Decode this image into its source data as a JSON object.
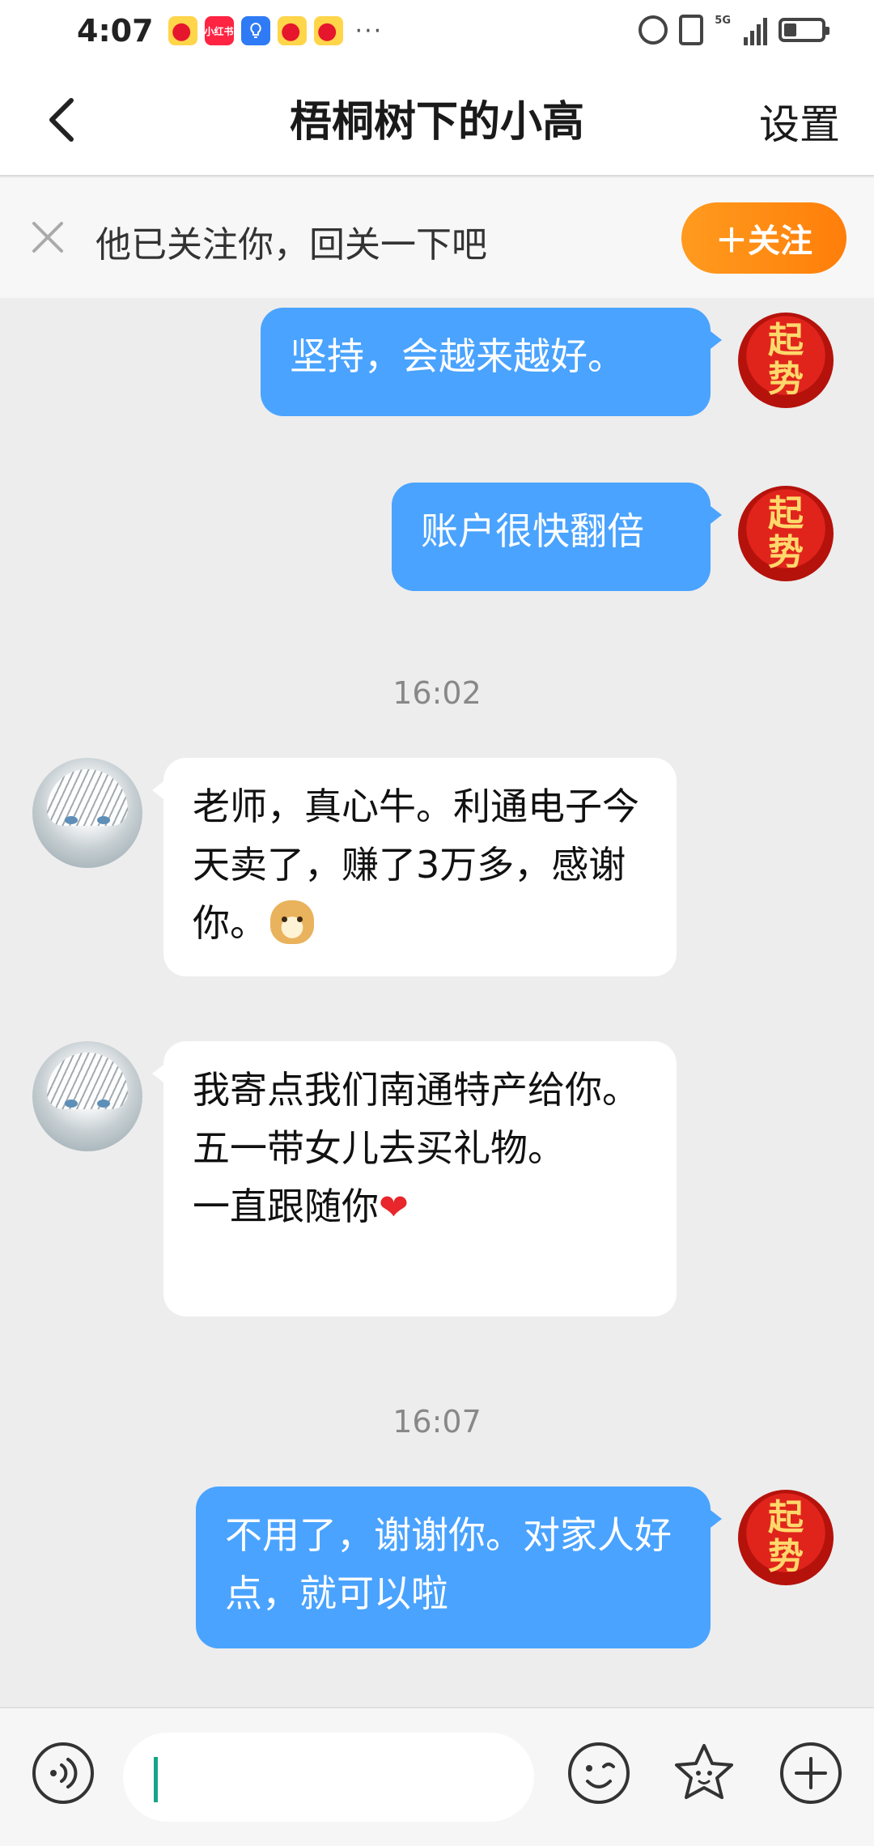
{
  "status_bar": {
    "time": "4:07",
    "notifications": [
      "weibo-icon",
      "xiaohongshu-icon",
      "bulb-icon",
      "weibo-icon",
      "weibo-icon"
    ],
    "xhs_label": "小红书",
    "more": "···",
    "network": "5G",
    "battery_level": 0.35
  },
  "nav": {
    "title": "梧桐树下的小高",
    "settings_label": "设置"
  },
  "follow_banner": {
    "text": "他已关注你，回关一下吧",
    "button_label": "＋关注",
    "accent_color": "#ff8a14"
  },
  "self_avatar_text": [
    "起",
    "势"
  ],
  "messages": [
    {
      "type": "out",
      "text": "坚持，会越来越好。"
    },
    {
      "type": "out",
      "text": "账户很快翻倍"
    },
    {
      "type": "time",
      "text": "16:02"
    },
    {
      "type": "in",
      "text": "老师，真心牛。利通电子今天卖了，赚了3万多，感谢你。",
      "emoji": "doge-emoji"
    },
    {
      "type": "in",
      "lines": [
        "我寄点我们南通特产给你。",
        "五一带女儿去买礼物。",
        "一直跟随你"
      ],
      "emoji": "heart-emoji"
    },
    {
      "type": "time",
      "text": "16:07"
    },
    {
      "type": "out",
      "text": "不用了，谢谢你。对家人好点，就可以啦"
    }
  ],
  "colors": {
    "outgoing_bubble": "#4aa3ff",
    "incoming_bubble": "#ffffff",
    "chat_background": "#ededed"
  }
}
